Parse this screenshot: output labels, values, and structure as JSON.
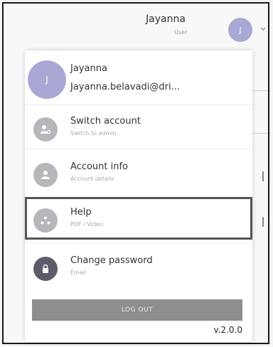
{
  "header": {
    "user_name": "Jayanna",
    "user_role": "User",
    "avatar_initial": "J"
  },
  "menu": {
    "profile": {
      "avatar_initial": "J",
      "name": "Jayanna",
      "email": "Jayanna.belavadi@dri..."
    },
    "items": [
      {
        "label": "Switch account",
        "sub": "Switch to admin",
        "icon": "switch-account-icon"
      },
      {
        "label": "Account info",
        "sub": "Account details",
        "icon": "account-icon"
      },
      {
        "label": "Help",
        "sub": "PDF / Video",
        "icon": "help-icon"
      },
      {
        "label": "Change password",
        "sub": "Email",
        "icon": "lock-icon"
      }
    ],
    "logout_label": "LOG OUT",
    "version": "v.2.0.0"
  },
  "colors": {
    "avatar": "#a9a7d4",
    "icon_bg": "#b6b6bb",
    "logout_bg": "#8e8e8e"
  }
}
